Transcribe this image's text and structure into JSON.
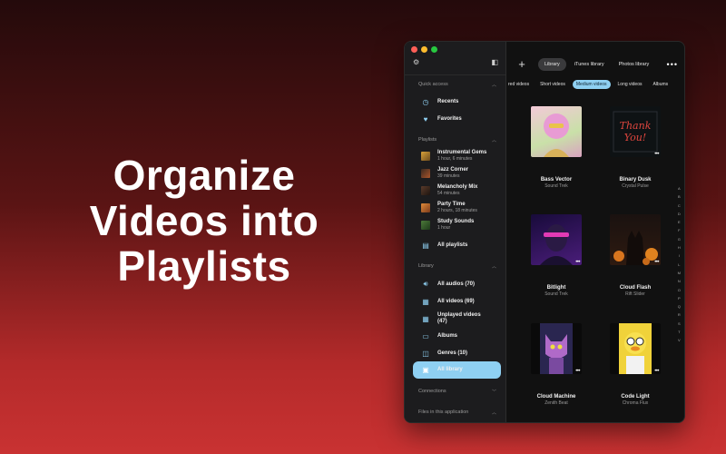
{
  "headline": [
    "Organize",
    "Videos into",
    "Playlists"
  ],
  "window": {
    "topbar": {
      "add_label": "+",
      "segments": [
        "Library",
        "iTunes library",
        "Photos library"
      ],
      "active_segment": 0,
      "more_label": "•••"
    },
    "filters": [
      "red videos",
      "Short videos",
      "Medium videos",
      "Long videos",
      "Albums"
    ],
    "active_filter": 2,
    "sidebar": {
      "quick_access_title": "Quick access",
      "recents": "Recents",
      "favorites": "Favorites",
      "playlists_title": "Playlists",
      "playlists": [
        {
          "name": "Instrumental Gems",
          "duration": "1 hour, 6 minutes"
        },
        {
          "name": "Jazz Corner",
          "duration": "39 minutes"
        },
        {
          "name": "Melancholy Mix",
          "duration": "54 minutes"
        },
        {
          "name": "Party Time",
          "duration": "2 hours, 18 minutes"
        },
        {
          "name": "Study Sounds",
          "duration": "1 hour"
        }
      ],
      "all_playlists": "All playlists",
      "library_title": "Library",
      "library_items": [
        "All audios (70)",
        "All videos (69)",
        "Unplayed videos (47)",
        "Albums",
        "Genres (10)",
        "All library"
      ],
      "connections_title": "Connections",
      "files_title": "Files in this application"
    },
    "grid": [
      {
        "title": "Bass Vector",
        "artist": "Sound Trek"
      },
      {
        "title": "Binary Dusk",
        "artist": "Crystal Pulse",
        "art_text": "Thank You!"
      },
      {
        "title": "Bitlight",
        "artist": "Sound Trek"
      },
      {
        "title": "Cloud Flash",
        "artist": "Rift Slider"
      },
      {
        "title": "Cloud Machine",
        "artist": "Zenith Beat"
      },
      {
        "title": "Code Light",
        "artist": "Chroma Flux"
      }
    ],
    "alphabet": [
      "A",
      "B",
      "C",
      "D",
      "E",
      "F",
      "G",
      "H",
      "I",
      "L",
      "M",
      "N",
      "O",
      "P",
      "Q",
      "R",
      "S",
      "T",
      "V"
    ]
  },
  "colors": {
    "accent": "#8fd0f2",
    "window_bg": "#111111",
    "sidebar_bg": "#1c1c1e",
    "background_top": "#240a0b",
    "background_bottom": "#c93232"
  }
}
